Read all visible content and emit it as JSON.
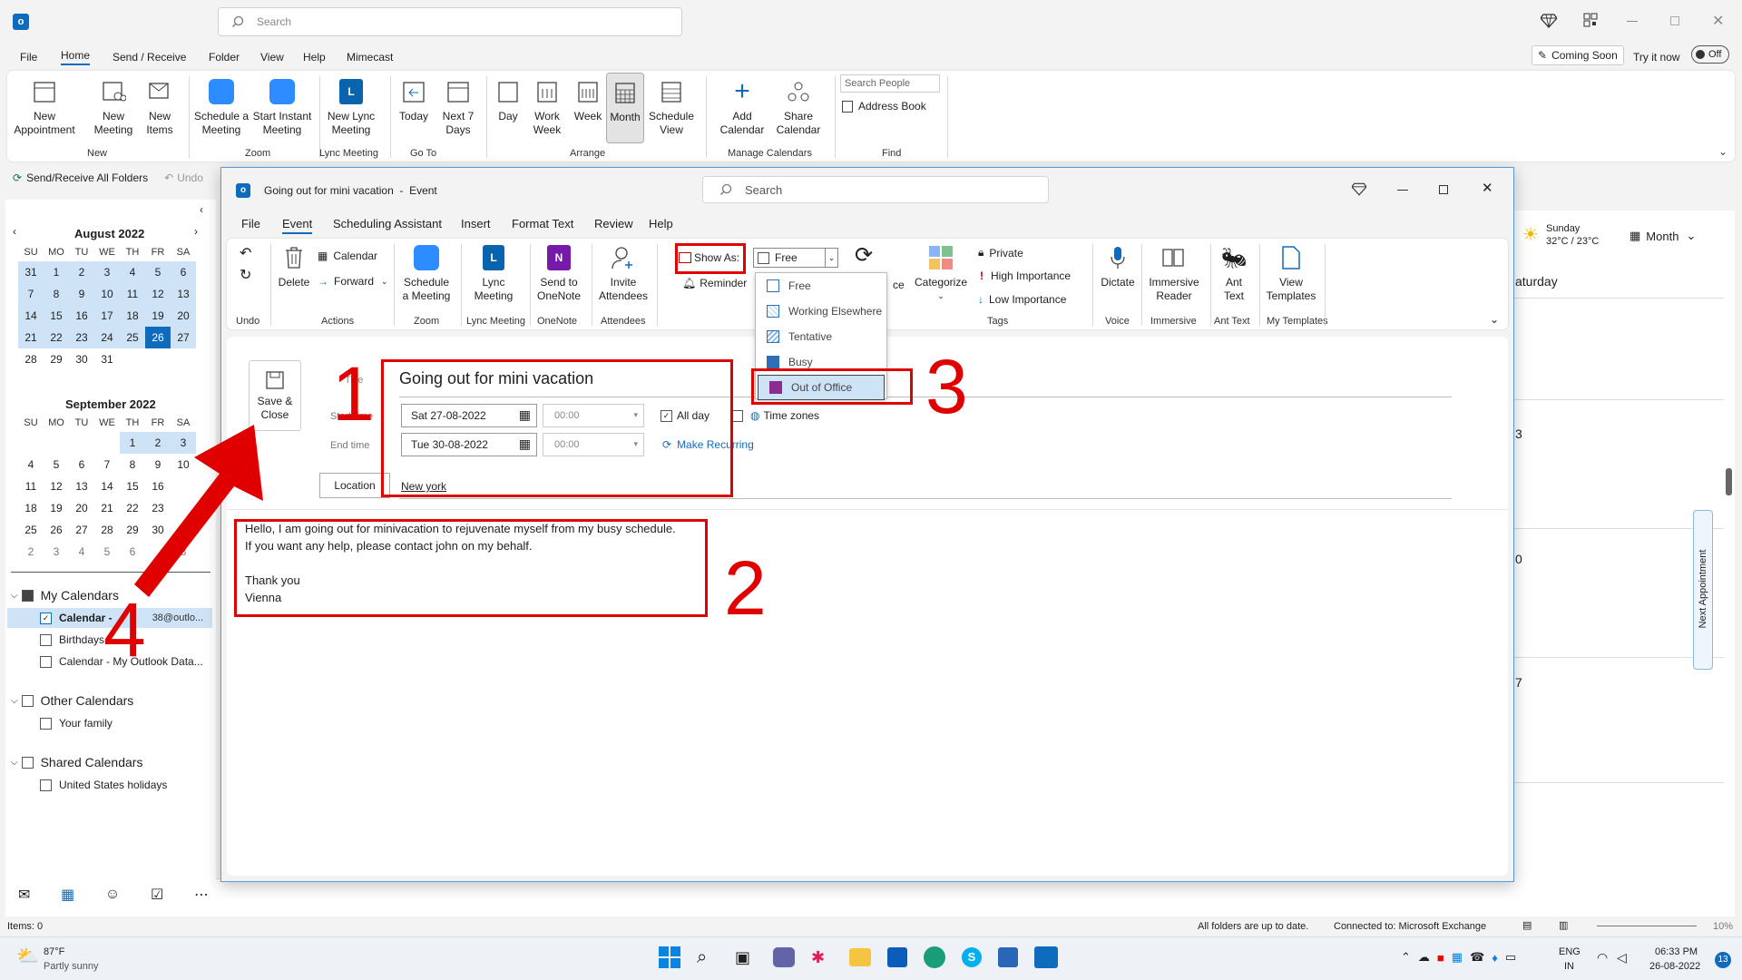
{
  "main": {
    "search_placeholder": "Search",
    "menu": [
      "File",
      "Home",
      "Send / Receive",
      "Folder",
      "View",
      "Help",
      "Mimecast"
    ],
    "coming_soon": "Coming Soon",
    "try_it_now": "Try it now",
    "toggle_off": "Off",
    "ribbon": {
      "new_appointment": "New Appointment",
      "new_meeting": "New Meeting",
      "new_items": "New Items",
      "group_new": "New",
      "schedule_meeting": "Schedule a Meeting",
      "start_instant": "Start Instant Meeting",
      "group_zoom": "Zoom",
      "new_lync": "New Lync Meeting",
      "group_lync": "Lync Meeting",
      "today": "Today",
      "next7": "Next 7 Days",
      "group_goto": "Go To",
      "day": "Day",
      "work_week": "Work Week",
      "week": "Week",
      "month": "Month",
      "schedule_view": "Schedule View",
      "group_arrange": "Arrange",
      "add_calendar": "Add Calendar",
      "share_calendar": "Share Calendar",
      "group_manage": "Manage Calendars",
      "search_people": "Search People",
      "address_book": "Address Book",
      "group_find": "Find"
    },
    "send_receive_all": "Send/Receive All Folders",
    "undo": "Undo",
    "weather_day": "Sunday",
    "weather_temp": "32°C / 23°C",
    "view_month": "Month",
    "saturday": "aturday",
    "side_next_appointment": "Next Appointment",
    "grid_numbers": [
      "3",
      "0",
      "7"
    ],
    "status_items": "Items: 0",
    "status_folders": "All folders are up to date.",
    "status_connected": "Connected to: Microsoft Exchange",
    "zoom_pct": "10%"
  },
  "sidebar": {
    "aug_title": "August 2022",
    "sep_title": "September 2022",
    "weekdays": [
      "SU",
      "MO",
      "TU",
      "WE",
      "TH",
      "FR",
      "SA"
    ],
    "aug_weeks": [
      [
        "31",
        "1",
        "2",
        "3",
        "4",
        "5",
        "6"
      ],
      [
        "7",
        "8",
        "9",
        "10",
        "11",
        "12",
        "13"
      ],
      [
        "14",
        "15",
        "16",
        "17",
        "18",
        "19",
        "20"
      ],
      [
        "21",
        "22",
        "23",
        "24",
        "25",
        "26",
        "27"
      ],
      [
        "28",
        "29",
        "30",
        "31",
        "",
        "",
        ""
      ]
    ],
    "sep_weeks": [
      [
        "",
        "",
        "",
        "",
        "1",
        "2",
        "3"
      ],
      [
        "4",
        "5",
        "6",
        "7",
        "8",
        "9",
        "10"
      ],
      [
        "11",
        "12",
        "13",
        "14",
        "15",
        "16",
        ""
      ],
      [
        "18",
        "19",
        "20",
        "21",
        "22",
        "23",
        ""
      ],
      [
        "25",
        "26",
        "27",
        "28",
        "29",
        "30",
        ""
      ],
      [
        "2",
        "3",
        "4",
        "5",
        "6",
        "",
        "8"
      ]
    ],
    "my_calendars": "My Calendars",
    "calendar_item": "Calendar -",
    "calendar_email": "38@outlo...",
    "birthdays": "Birthdays",
    "calendar_data": "Calendar - My Outlook Data...",
    "other_calendars": "Other Calendars",
    "your_family": "Your family",
    "shared_calendars": "Shared Calendars",
    "us_holidays": "United States holidays"
  },
  "event": {
    "window_title": "Going out for mini vacation  -  Event",
    "search_placeholder": "Search",
    "tabs": [
      "File",
      "Event",
      "Scheduling Assistant",
      "Insert",
      "Format Text",
      "Review",
      "Help"
    ],
    "undo_group": "Undo",
    "delete": "Delete",
    "calendar": "Calendar",
    "forward": "Forward",
    "group_actions": "Actions",
    "schedule_meeting": "Schedule a Meeting",
    "group_zoom": "Zoom",
    "lync_meeting": "Lync Meeting",
    "group_lync": "Lync Meeting",
    "send_onenote": "Send to OneNote",
    "group_onenote": "OneNote",
    "invite_attendees": "Invite Attendees",
    "group_attendees": "Attendees",
    "show_as": "Show As:",
    "show_as_value": "Free",
    "reminder": "Reminder",
    "ce_fragment": "ce",
    "categorize": "Categorize",
    "private": "Private",
    "high_importance": "High Importance",
    "low_importance": "Low Importance",
    "group_tags": "Tags",
    "dictate": "Dictate",
    "group_voice": "Voice",
    "immersive_reader": "Immersive Reader",
    "group_immersive": "Immersive",
    "ant_text": "Ant Text",
    "group_ant": "Ant Text",
    "view_templates": "View Templates",
    "group_templates": "My Templates",
    "dropdown": [
      "Free",
      "Working Elsewhere",
      "Tentative",
      "Busy",
      "Out of Office"
    ],
    "save_close": "Save & Close",
    "title_label": "Title",
    "title_value": "Going out for mini vacation",
    "start_label": "Start time",
    "start_date": "Sat 27-08-2022",
    "start_time": "00:00",
    "all_day": "All day",
    "time_zones": "Time zones",
    "end_label": "End time",
    "end_date": "Tue 30-08-2022",
    "end_time": "00:00",
    "make_recurring": "Make Recurring",
    "location_btn": "Location",
    "location_value": "New york",
    "body_line1": "Hello, I am going out for minivacation to rejuvenate myself from my busy schedule.",
    "body_line2": "If you want any help, please contact john on my behalf.",
    "body_line3": "Thank you",
    "body_line4": "Vienna"
  },
  "annotations": [
    "1",
    "2",
    "3",
    "4"
  ],
  "taskbar": {
    "temp": "87°F",
    "weather": "Partly sunny",
    "lang1": "ENG",
    "lang2": "IN",
    "time": "06:33 PM",
    "date": "26-08-2022",
    "notif": "13"
  },
  "colors": {
    "accent": "#0f6cbd",
    "annotation": "#e00000",
    "out_of_office": "#8a2d8f"
  }
}
